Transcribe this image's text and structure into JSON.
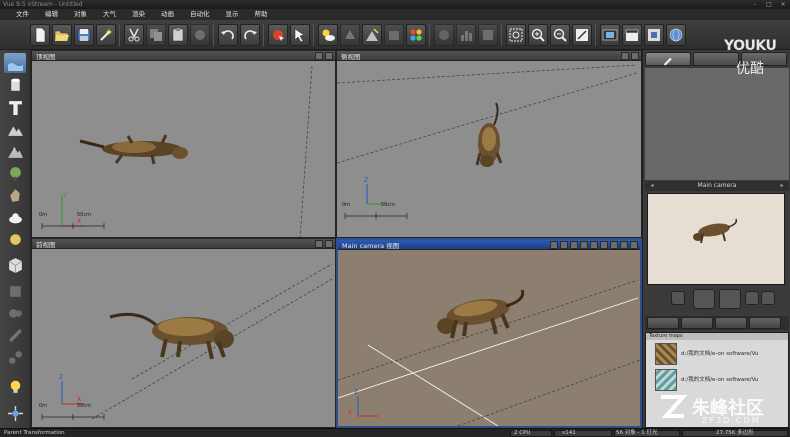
{
  "window": {
    "title": "Vue 9.5 xStream - Untitled",
    "controls": [
      "-",
      "□",
      "×"
    ]
  },
  "menu": [
    "文件",
    "编辑",
    "对象",
    "大气",
    "渲染",
    "动画",
    "自动化",
    "显示",
    "帮助"
  ],
  "toolbar": {
    "icons": [
      "new-file-icon",
      "open-file-icon",
      "save-file-icon",
      "render-wand-icon",
      "cut-icon",
      "copy-icon",
      "paste-icon",
      "delete-icon",
      "undo-icon",
      "redo-icon",
      "select-arrow-icon",
      "move-pointer-icon",
      "sun-cloud-icon",
      "atmosphere-icon",
      "terrain-icon",
      "plant-editor-icon",
      "material-icon",
      "palette-icon",
      "render-icon",
      "render-area-icon",
      "render-stats-icon",
      "render-options-icon",
      "zoom-box-icon",
      "zoom-in-icon",
      "zoom-out-icon",
      "fit-view-icon",
      "film-strip-icon",
      "clapper-icon",
      "frame-icon",
      "globe-icon"
    ]
  },
  "left_tools": [
    "water-plane-icon",
    "cylinder-icon",
    "text-icon",
    "mountain-icon",
    "snowy-mountain-icon",
    "tree-icon",
    "rock-icon",
    "cloud-icon",
    "planet-icon",
    "cube-object-icon",
    "group-icon",
    "metablob-icon",
    "boolean-icon",
    "link-icon",
    "light-bulb-icon",
    "camera-gyro-icon"
  ],
  "viewports": [
    {
      "label": "顶视图",
      "scale_zero": "0m",
      "scale_len": "50cm"
    },
    {
      "label": "侧视图",
      "scale_zero": "0m",
      "scale_len": "50cm"
    },
    {
      "label": "前视图",
      "scale_zero": "0m",
      "scale_len": "50cm"
    },
    {
      "label": "Main camera 视图",
      "active": true
    }
  ],
  "axis_labels": {
    "x": "X",
    "y": "Y",
    "z": "Z"
  },
  "right_panel": {
    "camera_title": "Main camera",
    "nav_prev": "◂",
    "nav_next": "▸",
    "texture_header": "Texture maps",
    "texture_maps": [
      "d:/我的文档/e-on software/Vu",
      "d:/我的文档/e-on software/Vu"
    ]
  },
  "status": {
    "left": "Parent Transformation",
    "cpu": "2 CPU",
    "frame": "x141",
    "objects": "56 对象 - 1 灯光",
    "polygons": "27.75K 多边形"
  },
  "watermarks": {
    "youku_en": "YOUKU",
    "youku_cn": "优酷",
    "zf3d_cn": "朱峰社区",
    "zf3d_url": "ZF3D.COM"
  },
  "colors": {
    "viewport_bg": "#8e8e8e",
    "camera_view_bg": "#8d7f6f",
    "active_header": "#2d5ab4",
    "preview_bg": "#e6ded2"
  }
}
